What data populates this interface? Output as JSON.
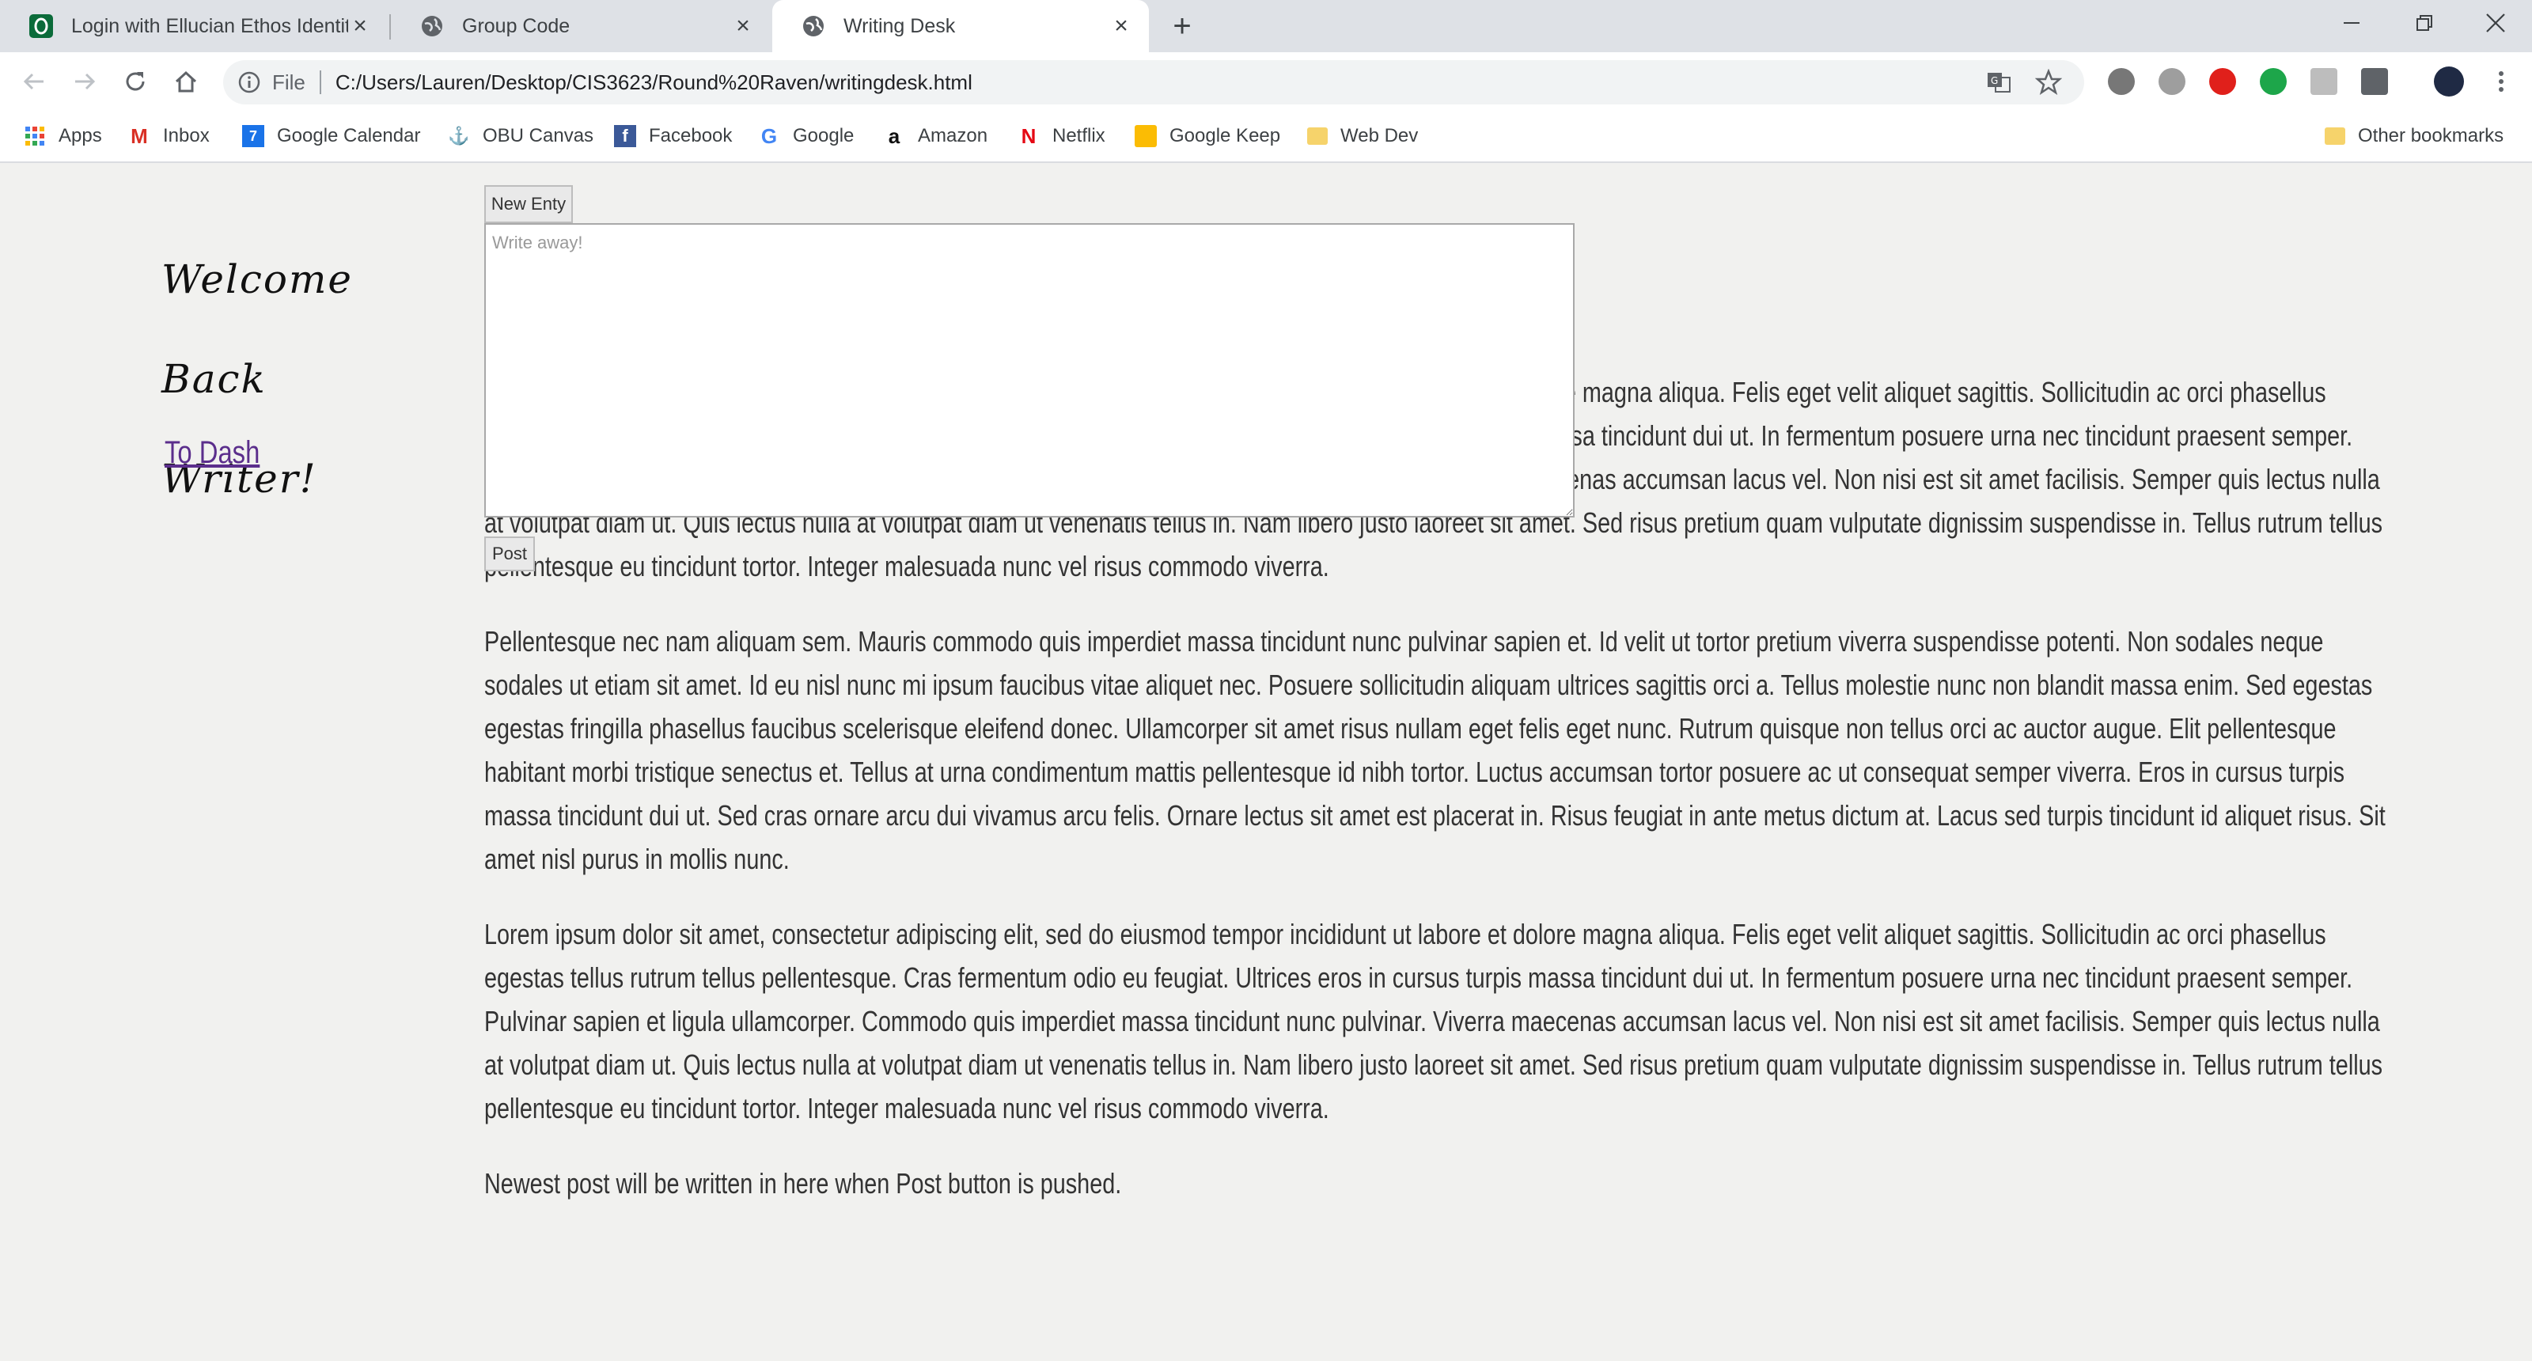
{
  "browser": {
    "tabs": [
      {
        "title": "Login with Ellucian Ethos Identity",
        "icon": "ellucian-icon"
      },
      {
        "title": "Group Code",
        "icon": "globe-icon"
      },
      {
        "title": "Writing Desk",
        "icon": "globe-icon"
      }
    ],
    "address": {
      "scheme": "File",
      "url": "C:/Users/Lauren/Desktop/CIS3623/Round%20Raven/writingdesk.html"
    },
    "bookmarks": [
      {
        "label": "Apps",
        "icon": "apps-grid-icon"
      },
      {
        "label": "Inbox",
        "icon": "gmail-icon"
      },
      {
        "label": "Google Calendar",
        "icon": "calendar-icon"
      },
      {
        "label": "OBU Canvas",
        "icon": "canvas-icon"
      },
      {
        "label": "Facebook",
        "icon": "facebook-icon"
      },
      {
        "label": "Google",
        "icon": "google-icon"
      },
      {
        "label": "Amazon",
        "icon": "amazon-icon"
      },
      {
        "label": "Netflix",
        "icon": "netflix-icon"
      },
      {
        "label": "Google Keep",
        "icon": "keep-icon"
      },
      {
        "label": "Web Dev",
        "icon": "folder-icon"
      }
    ],
    "other_bookmarks": "Other bookmarks",
    "colors": {
      "tabstrip": "#dee1e6",
      "toolbar": "#ffffff",
      "link_visited": "#5b2e8c"
    }
  },
  "page": {
    "welcome_line1": "Welcome Back",
    "welcome_line2": "Writer!",
    "dash_link": "To Dash",
    "new_entry_button": "New Enty",
    "editor_placeholder": "Write away!",
    "post_button": "Post",
    "paragraphs": [
      "Lorem ipsum dolor sit amet, consectetur adipiscing elit, sed do eiusmod tempor incididunt ut labore et dolore magna aliqua. Felis eget velit aliquet sagittis. Sollicitudin ac orci phasellus egestas tellus rutrum tellus pellentesque. Cras fermentum odio eu feugiat. Ultrices eros in cursus turpis massa tincidunt dui ut. In fermentum posuere urna nec tincidunt praesent semper. Pulvinar sapien et ligula ullamcorper. Commodo quis imperdiet massa tincidunt nunc pulvinar. Viverra maecenas accumsan lacus vel. Non nisi est sit amet facilisis. Semper quis lectus nulla at volutpat diam ut. Quis lectus nulla at volutpat diam ut venenatis tellus in. Nam libero justo laoreet sit amet. Sed risus pretium quam vulputate dignissim suspendisse in. Tellus rutrum tellus pellentesque eu tincidunt tortor. Integer malesuada nunc vel risus commodo viverra.",
      "Pellentesque nec nam aliquam sem. Mauris commodo quis imperdiet massa tincidunt nunc pulvinar sapien et. Id velit ut tortor pretium viverra suspendisse potenti. Non sodales neque sodales ut etiam sit amet. Id eu nisl nunc mi ipsum faucibus vitae aliquet nec. Posuere sollicitudin aliquam ultrices sagittis orci a. Tellus molestie nunc non blandit massa enim. Sed egestas egestas fringilla phasellus faucibus scelerisque eleifend donec. Ullamcorper sit amet risus nullam eget felis eget nunc. Rutrum quisque non tellus orci ac auctor augue. Elit pellentesque habitant morbi tristique senectus et. Tellus at urna condimentum mattis pellentesque id nibh tortor. Luctus accumsan tortor posuere ac ut consequat semper viverra. Eros in cursus turpis massa tincidunt dui ut. Sed cras ornare arcu dui vivamus arcu felis. Ornare lectus sit amet est placerat in. Risus feugiat in ante metus dictum at. Lacus sed turpis tincidunt id aliquet risus. Sit amet nisl purus in mollis nunc.",
      "Lorem ipsum dolor sit amet, consectetur adipiscing elit, sed do eiusmod tempor incididunt ut labore et dolore magna aliqua. Felis eget velit aliquet sagittis. Sollicitudin ac orci phasellus egestas tellus rutrum tellus pellentesque. Cras fermentum odio eu feugiat. Ultrices eros in cursus turpis massa tincidunt dui ut. In fermentum posuere urna nec tincidunt praesent semper. Pulvinar sapien et ligula ullamcorper. Commodo quis imperdiet massa tincidunt nunc pulvinar. Viverra maecenas accumsan lacus vel. Non nisi est sit amet facilisis. Semper quis lectus nulla at volutpat diam ut. Quis lectus nulla at volutpat diam ut venenatis tellus in. Nam libero justo laoreet sit amet. Sed risus pretium quam vulputate dignissim suspendisse in. Tellus rutrum tellus pellentesque eu tincidunt tortor. Integer malesuada nunc vel risus commodo viverra.",
      "Newest post will be written in here when Post button is pushed."
    ]
  }
}
